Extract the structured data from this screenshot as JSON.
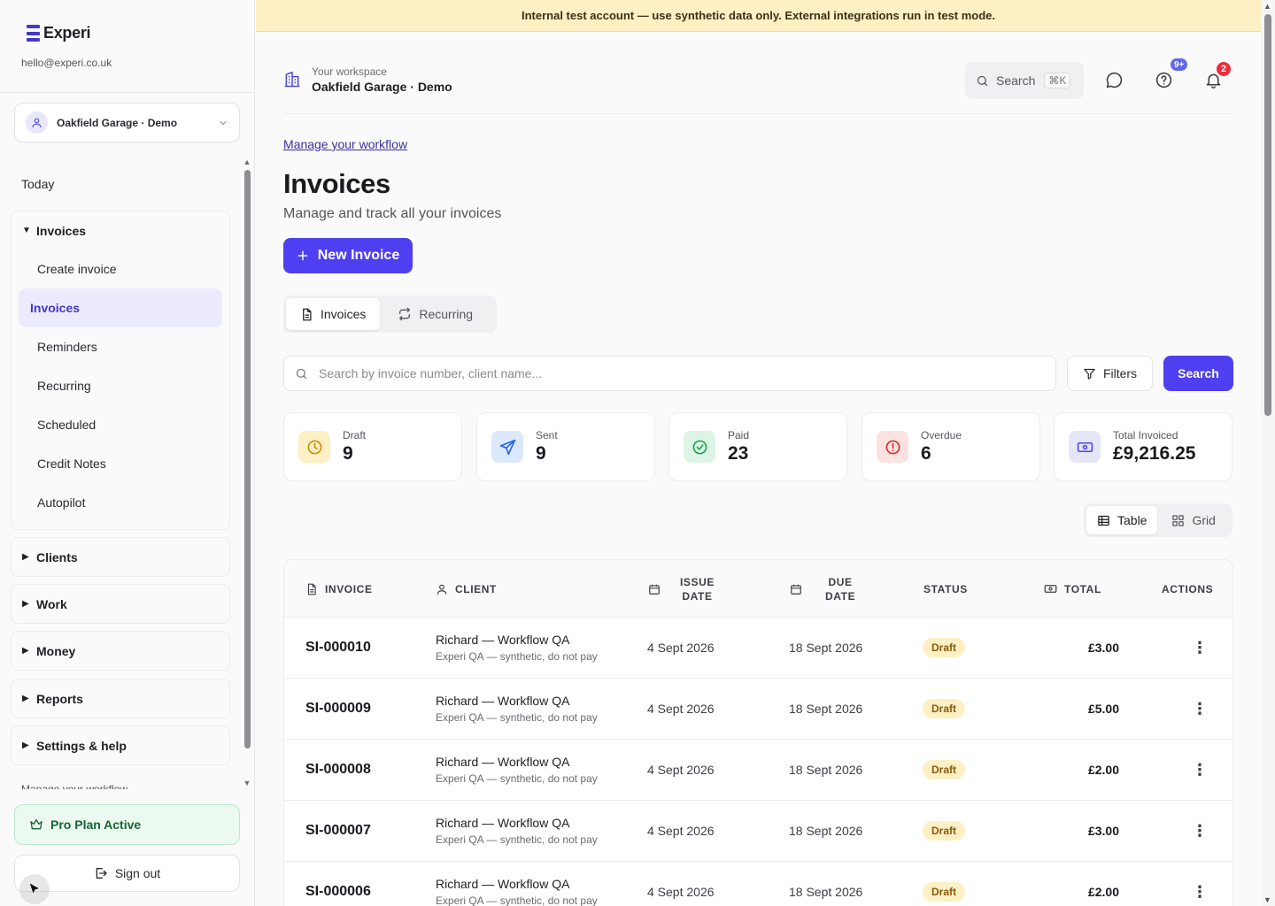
{
  "app": {
    "name": "Experi",
    "email": "hello@experi.co.uk",
    "brand_color": "#4f3ff0"
  },
  "banner": {
    "text": "Internal test account — use synthetic data only. External integrations run in test mode."
  },
  "sidebar": {
    "workspace_select": "Oakfield Garage · Demo",
    "today": "Today",
    "groups": [
      {
        "label": "Invoices",
        "expanded": true,
        "items": [
          {
            "label": "Create invoice"
          },
          {
            "label": "Invoices",
            "active": true
          },
          {
            "label": "Reminders"
          },
          {
            "label": "Recurring"
          },
          {
            "label": "Scheduled"
          },
          {
            "label": "Credit Notes"
          },
          {
            "label": "Autopilot"
          }
        ]
      },
      {
        "label": "Clients"
      },
      {
        "label": "Work"
      },
      {
        "label": "Money"
      },
      {
        "label": "Reports"
      },
      {
        "label": "Settings & help"
      }
    ],
    "cut_item": "Manage your workflow",
    "pro_plan": "Pro Plan Active",
    "sign_out": "Sign out"
  },
  "topbar": {
    "workspace_label": "Your workspace",
    "workspace_name": "Oakfield Garage · Demo",
    "search_label": "Search",
    "search_shortcut": "⌘K",
    "help_badge": "9+",
    "notifications_badge": "2"
  },
  "page": {
    "breadcrumb_link": "Manage your workflow",
    "title": "Invoices",
    "subtitle": "Manage and track all your invoices",
    "new_invoice": "New Invoice",
    "tabs": [
      {
        "label": "Invoices",
        "active": true
      },
      {
        "label": "Recurring"
      }
    ],
    "search_placeholder": "Search by invoice number, client name...",
    "filters": "Filters",
    "search_button": "Search"
  },
  "stats": [
    {
      "label": "Draft",
      "value": "9"
    },
    {
      "label": "Sent",
      "value": "9"
    },
    {
      "label": "Paid",
      "value": "23"
    },
    {
      "label": "Overdue",
      "value": "6"
    },
    {
      "label": "Total Invoiced",
      "value": "£9,216.25"
    }
  ],
  "view_toggle": {
    "table": "Table",
    "grid": "Grid",
    "active": "table"
  },
  "table": {
    "headers": {
      "invoice": "INVOICE",
      "client": "CLIENT",
      "issue_1": "ISSUE",
      "issue_2": "DATE",
      "due_1": "DUE",
      "due_2": "DATE",
      "status": "STATUS",
      "total": "TOTAL",
      "actions": "ACTIONS"
    },
    "rows": [
      {
        "invoice": "SI-000010",
        "client": "Richard — Workflow QA",
        "client_sub": "Experi QA — synthetic, do not pay",
        "issue": "4 Sept 2026",
        "due": "18 Sept 2026",
        "status": "Draft",
        "total": "£3.00"
      },
      {
        "invoice": "SI-000009",
        "client": "Richard — Workflow QA",
        "client_sub": "Experi QA — synthetic, do not pay",
        "issue": "4 Sept 2026",
        "due": "18 Sept 2026",
        "status": "Draft",
        "total": "£5.00"
      },
      {
        "invoice": "SI-000008",
        "client": "Richard — Workflow QA",
        "client_sub": "Experi QA — synthetic, do not pay",
        "issue": "4 Sept 2026",
        "due": "18 Sept 2026",
        "status": "Draft",
        "total": "£2.00"
      },
      {
        "invoice": "SI-000007",
        "client": "Richard — Workflow QA",
        "client_sub": "Experi QA — synthetic, do not pay",
        "issue": "4 Sept 2026",
        "due": "18 Sept 2026",
        "status": "Draft",
        "total": "£3.00"
      },
      {
        "invoice": "SI-000006",
        "client": "Richard — Workflow QA",
        "client_sub": "Experi QA — synthetic, do not pay",
        "issue": "4 Sept 2026",
        "due": "18 Sept 2026",
        "status": "Draft",
        "total": "£2.00"
      }
    ]
  }
}
